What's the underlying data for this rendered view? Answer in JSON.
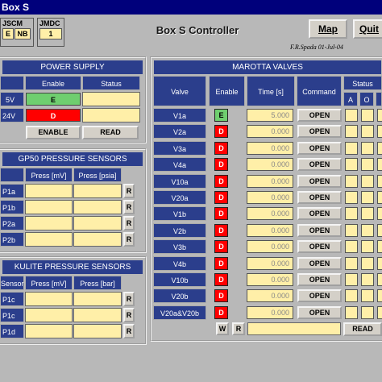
{
  "window": {
    "title": "Box S"
  },
  "jscm": {
    "label": "JSCM",
    "cells": [
      "E",
      "NB"
    ]
  },
  "jmdc": {
    "label": "JMDC",
    "value": "1"
  },
  "app": {
    "title": "Box S Controller",
    "author": "F.R.Spada 01-Jul-04"
  },
  "buttons": {
    "map": "Map",
    "quit": "Quit"
  },
  "power_supply": {
    "title": "POWER SUPPLY",
    "headers": [
      "Enable",
      "Status"
    ],
    "rows": [
      {
        "label": "5V",
        "enable": "E",
        "enable_color": "#6fce6f"
      },
      {
        "label": "24V",
        "enable": "D",
        "enable_color": "#ff0000"
      }
    ],
    "enable_button": "ENABLE",
    "read_button": "READ"
  },
  "gp50": {
    "title": "GP50 PRESSURE SENSORS",
    "headers": [
      "Press [mV]",
      "Press [psia]"
    ],
    "rows": [
      "P1a",
      "P1b",
      "P2a",
      "P2b"
    ],
    "button": "R"
  },
  "kulite": {
    "title": "KULITE PRESSURE SENSORS",
    "headers": [
      "Sensor",
      "Press [mV]",
      "Press [bar]"
    ],
    "rows": [
      "P1c",
      "P1c",
      "P1d"
    ],
    "button": "R"
  },
  "marotta": {
    "title": "MAROTTA VALVES",
    "headers": {
      "valve": "Valve",
      "enable": "Enable",
      "time": "Time [s]",
      "command": "Command",
      "status": "Status"
    },
    "status_sub": [
      "A",
      "O"
    ],
    "rows": [
      {
        "valve": "V1a",
        "enable": "E",
        "time": "5.000",
        "command": "OPEN"
      },
      {
        "valve": "V2a",
        "enable": "D",
        "time": "0.000",
        "command": "OPEN"
      },
      {
        "valve": "V3a",
        "enable": "D",
        "time": "0.000",
        "command": "OPEN"
      },
      {
        "valve": "V4a",
        "enable": "D",
        "time": "0.000",
        "command": "OPEN"
      },
      {
        "valve": "V10a",
        "enable": "D",
        "time": "0.000",
        "command": "OPEN"
      },
      {
        "valve": "V20a",
        "enable": "D",
        "time": "0.000",
        "command": "OPEN"
      },
      {
        "valve": "V1b",
        "enable": "D",
        "time": "0.000",
        "command": "OPEN"
      },
      {
        "valve": "V2b",
        "enable": "D",
        "time": "0.000",
        "command": "OPEN"
      },
      {
        "valve": "V3b",
        "enable": "D",
        "time": "0.000",
        "command": "OPEN"
      },
      {
        "valve": "V4b",
        "enable": "D",
        "time": "0.000",
        "command": "OPEN"
      },
      {
        "valve": "V10b",
        "enable": "D",
        "time": "0.000",
        "command": "OPEN"
      },
      {
        "valve": "V20b",
        "enable": "D",
        "time": "0.000",
        "command": "OPEN"
      },
      {
        "valve": "V20a&V20b",
        "enable": "D",
        "time": "0.000",
        "command": "OPEN"
      }
    ],
    "w_button": "W",
    "r_button": "R",
    "read_button": "READ"
  },
  "colors": {
    "enabled": "#6fce6f",
    "disabled": "#ff0000",
    "header": "#2b3e8c",
    "field": "#ffefa8"
  }
}
